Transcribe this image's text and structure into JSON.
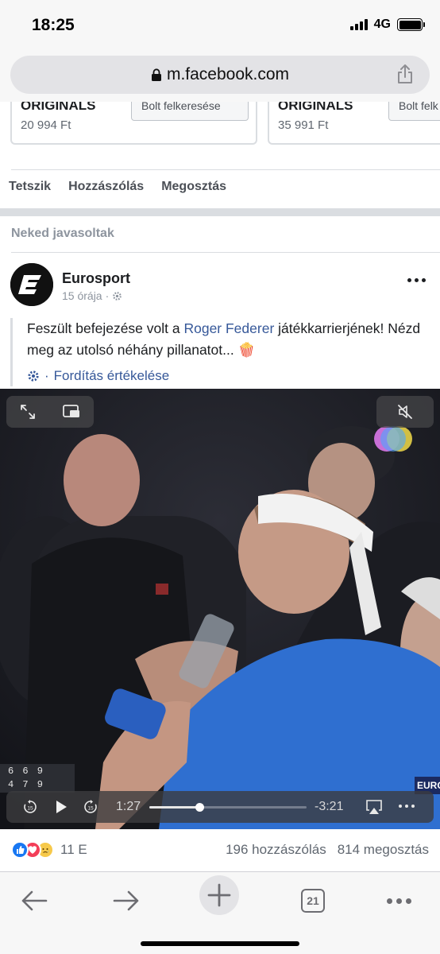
{
  "status_bar": {
    "time": "18:25",
    "network": "4G"
  },
  "browser": {
    "url": "m.facebook.com"
  },
  "products": [
    {
      "name": "ORIGINALS",
      "price": "20 994 Ft",
      "button": "Bolt felkeresése"
    },
    {
      "name": "ORIGINALS",
      "price": "35 991 Ft",
      "button": "Bolt felk"
    }
  ],
  "actions": {
    "like": "Tetszik",
    "comment": "Hozzászólás",
    "share": "Megosztás"
  },
  "section_title": "Neked javasoltak",
  "post": {
    "author": "Eurosport",
    "time": "15 órája",
    "text_before": "Feszült befejezése volt a ",
    "text_link": "Roger Federer",
    "text_after": " játékkarrierjének! Nézd meg az utolsó néhány pillanatot... 🍿",
    "translate": "Fordítás értékelése"
  },
  "video": {
    "current_time": "1:27",
    "remaining_time": "-3:21",
    "progress": 0.32,
    "skip_seconds": "15",
    "scoreboard_rows": [
      "6 6 9",
      "4 7 9"
    ],
    "broadcaster_text": "EURO"
  },
  "reactions": {
    "count": "11 E",
    "types": [
      "like",
      "love",
      "sad"
    ]
  },
  "stats": {
    "comments": "196 hozzászólás",
    "shares": "814 megosztás"
  },
  "toolbar": {
    "tabs": "21"
  },
  "colors": {
    "link": "#365899",
    "muted": "#606770",
    "divider": "#dadde1",
    "jersey": "#2f6fd0"
  }
}
